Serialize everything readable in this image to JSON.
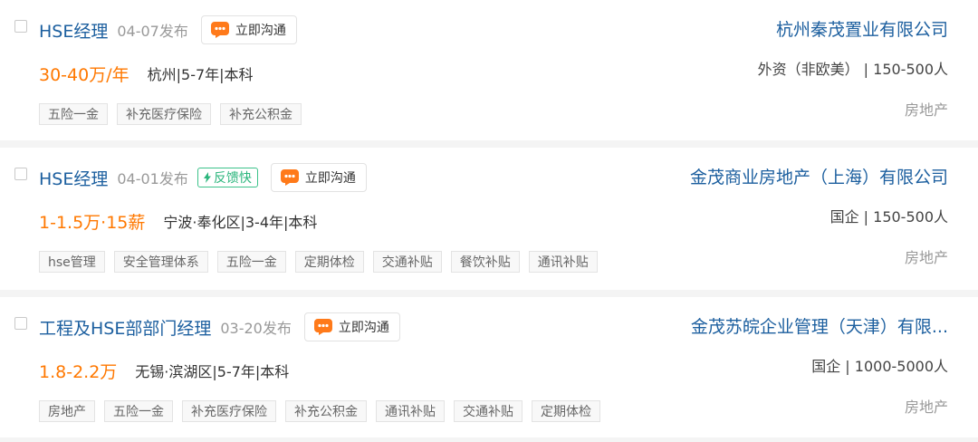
{
  "colors": {
    "title": "#1c5f9f",
    "salary": "#ff7800",
    "fast_badge": "#2cb67d",
    "chat_icon": "#ff7a1a"
  },
  "chat_button_label": "立即沟通",
  "jobs": [
    {
      "title": "HSE经理",
      "date": "04-07发布",
      "fast_badge": null,
      "salary": "30-40万/年",
      "meta": "杭州|5-7年|本科",
      "tags": [
        "五险一金",
        "补充医疗保险",
        "补充公积金"
      ],
      "company": "杭州秦茂置业有限公司",
      "company_meta": "外资（非欧美） | 150-500人",
      "industry": "房地产"
    },
    {
      "title": "HSE经理",
      "date": "04-01发布",
      "fast_badge": "反馈快",
      "salary": "1-1.5万·15薪",
      "meta": "宁波·奉化区|3-4年|本科",
      "tags": [
        "hse管理",
        "安全管理体系",
        "五险一金",
        "定期体检",
        "交通补贴",
        "餐饮补贴",
        "通讯补贴"
      ],
      "company": "金茂商业房地产（上海）有限公司",
      "company_meta": "国企 | 150-500人",
      "industry": "房地产"
    },
    {
      "title": "工程及HSE部部门经理",
      "date": "03-20发布",
      "fast_badge": null,
      "salary": "1.8-2.2万",
      "meta": "无锡·滨湖区|5-7年|本科",
      "tags": [
        "房地产",
        "五险一金",
        "补充医疗保险",
        "补充公积金",
        "通讯补贴",
        "交通补贴",
        "定期体检"
      ],
      "company": "金茂苏皖企业管理（天津）有限...",
      "company_meta": "国企 | 1000-5000人",
      "industry": "房地产"
    }
  ]
}
